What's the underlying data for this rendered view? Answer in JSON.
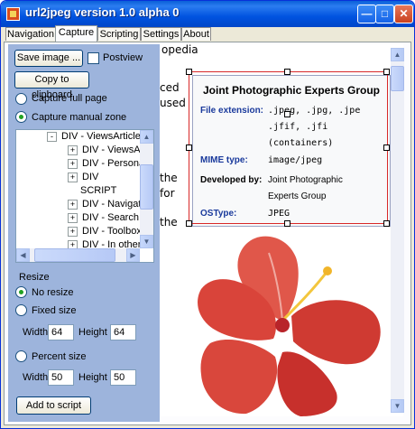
{
  "window": {
    "title": "url2jpeg version 1.0 alpha 0"
  },
  "tabs": [
    "Navigation",
    "Capture",
    "Scripting",
    "Settings",
    "About"
  ],
  "capture": {
    "save_image_label": "Save image ...",
    "postview_label": "Postview",
    "copy_label": "Copy to clipboard",
    "full_page_label": "Capture full page",
    "manual_zone_label": "Capture manual zone",
    "selected_mode": "manual_zone"
  },
  "tree": {
    "items": [
      {
        "label": "DIV - ViewsArticle D",
        "expander": "-"
      },
      {
        "label": "DIV - ViewsArtic",
        "expander": "+"
      },
      {
        "label": "DIV - Personal to",
        "expander": "+"
      },
      {
        "label": "DIV",
        "expander": "+"
      },
      {
        "label": "SCRIPT",
        "expander": ""
      },
      {
        "label": "DIV - Navigation",
        "expander": "+"
      },
      {
        "label": "DIV - SearchⅡ",
        "expander": "+"
      },
      {
        "label": "DIV - ToolboxⅡV",
        "expander": "+"
      },
      {
        "label": "DIV - In other la",
        "expander": "+"
      }
    ]
  },
  "resize": {
    "heading": "Resize",
    "no_resize_label": "No resize",
    "fixed_size_label": "Fixed size",
    "fixed_width_label": "Width",
    "fixed_width_value": "64",
    "fixed_height_label": "Height",
    "fixed_height_value": "64",
    "percent_label": "Percent size",
    "percent_width_label": "Width",
    "percent_width_value": "50",
    "percent_height_label": "Height",
    "percent_height_value": "50",
    "selected": "no_resize"
  },
  "add_script_label": "Add to script",
  "browser": {
    "fragments": [
      "opedia",
      "ced",
      "used",
      "the",
      "for",
      "the"
    ],
    "infobox": {
      "title": "Joint Photographic Experts Group",
      "file_ext_key": "File extension:",
      "file_ext_lines": [
        ".jpeg, .jpg, .jpe",
        ".jfif, .jfi",
        "(containers)"
      ],
      "mime_key": "MIME type:",
      "mime_val": "image/jpeg",
      "dev_key": "Developed by:",
      "dev_lines": [
        "Joint Photographic",
        "Experts Group"
      ],
      "os_key": "OSType:",
      "os_val": "JPEG"
    }
  },
  "colors": {
    "selection": "#d82828",
    "panel": "#9db4dc",
    "infobox_key": "#1a3a9c"
  }
}
